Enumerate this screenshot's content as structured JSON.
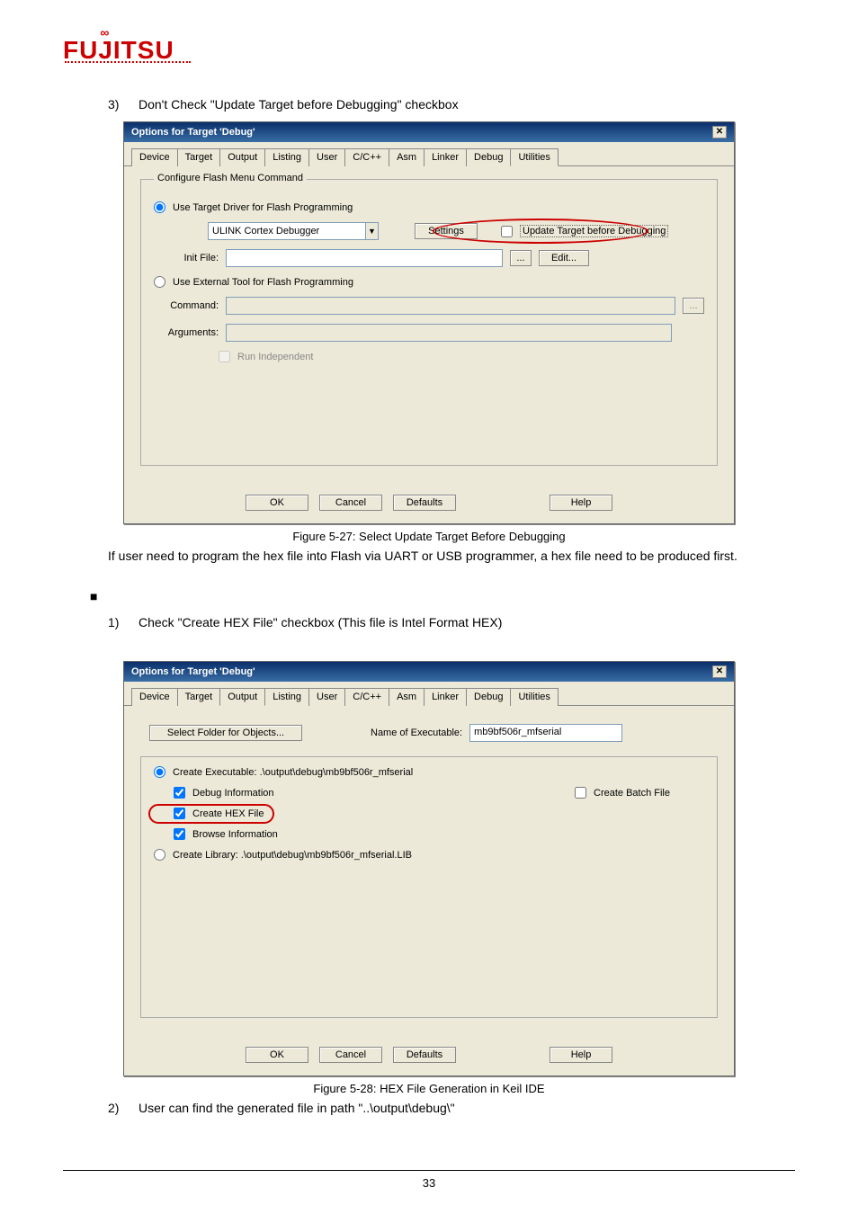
{
  "logo": {
    "text": "FUJITSU"
  },
  "item3": {
    "num": "3)",
    "text": "Don't Check \"Update Target before Debugging\" checkbox"
  },
  "dlg1": {
    "title": "Options for Target 'Debug'",
    "tabs": [
      "Device",
      "Target",
      "Output",
      "Listing",
      "User",
      "C/C++",
      "Asm",
      "Linker",
      "Debug",
      "Utilities"
    ],
    "active_tab": "Utilities",
    "group_title": "Configure Flash Menu Command",
    "radio1": "Use Target Driver for Flash Programming",
    "combo_val": "ULINK Cortex Debugger",
    "settings_btn": "Settings",
    "upd_chk": "Update Target before Debugging",
    "init_lbl": "Init File:",
    "edit_btn": "Edit...",
    "dots_btn": "...",
    "radio2": "Use External Tool for Flash Programming",
    "cmd_lbl": "Command:",
    "args_lbl": "Arguments:",
    "run_indep": "Run Independent",
    "ok": "OK",
    "cancel": "Cancel",
    "defaults": "Defaults",
    "help": "Help"
  },
  "fig1": "Figure 5-27:  Select Update Target Before Debugging",
  "para1": "If user need to program the hex file into Flash via UART or USB programmer, a hex file need to be produced first.",
  "bullet": "■",
  "item1b": {
    "num": "1)",
    "text": "Check \"Create HEX File\" checkbox (This file is Intel Format HEX)"
  },
  "dlg2": {
    "title": "Options for Target 'Debug'",
    "tabs": [
      "Device",
      "Target",
      "Output",
      "Listing",
      "User",
      "C/C++",
      "Asm",
      "Linker",
      "Debug",
      "Utilities"
    ],
    "active_tab": "Output",
    "selfolder_btn": "Select Folder for Objects...",
    "name_lbl": "Name of Executable:",
    "name_val": "mb9bf506r_mfserial",
    "radio1": "Create Executable:  .\\output\\debug\\mb9bf506r_mfserial",
    "chk_dbg": "Debug Information",
    "chk_batch": "Create Batch File",
    "chk_hex": "Create HEX File",
    "chk_browse": "Browse Information",
    "radio2": "Create Library:  .\\output\\debug\\mb9bf506r_mfserial.LIB",
    "ok": "OK",
    "cancel": "Cancel",
    "defaults": "Defaults",
    "help": "Help"
  },
  "fig2": "Figure 5-28:  HEX File Generation in Keil IDE",
  "item2b": {
    "num": "2)",
    "text": "User can find the generated file in path \"..\\output\\debug\\\""
  },
  "page_num": "33"
}
